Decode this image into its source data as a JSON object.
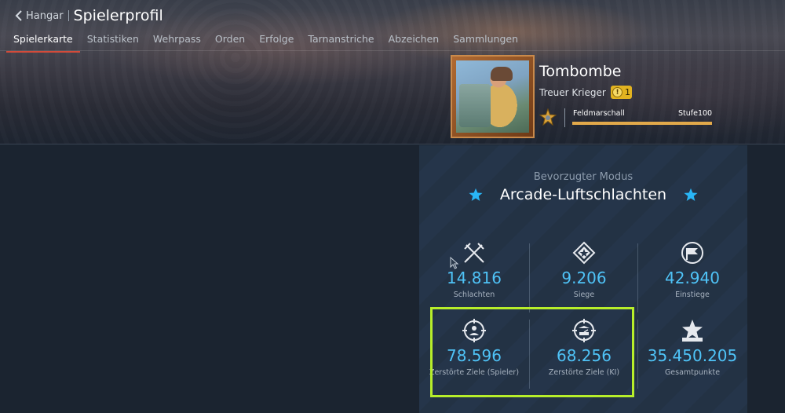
{
  "header": {
    "back_label": "Hangar",
    "title": "Spielerprofil",
    "tabs": [
      {
        "label": "Spielerkarte",
        "active": true
      },
      {
        "label": "Statistiken"
      },
      {
        "label": "Wehrpass"
      },
      {
        "label": "Orden"
      },
      {
        "label": "Erfolge"
      },
      {
        "label": "Tarnanstriche"
      },
      {
        "label": "Abzeichen"
      },
      {
        "label": "Sammlungen"
      }
    ]
  },
  "profile": {
    "name": "Tombombe",
    "title": "Treuer Krieger",
    "badge_count": "1",
    "rank_name": "Feldmarschall",
    "rank_level": "Stufe100",
    "rank_progress": 1.0
  },
  "stats": {
    "mode_label": "Bevorzugter Modus",
    "mode_name": "Arcade-Luftschlachten",
    "items": [
      {
        "icon": "crossed-swords-icon",
        "value": "14.816",
        "label": "Schlachten"
      },
      {
        "icon": "victory-diamond-icon",
        "value": "9.206",
        "label": "Siege"
      },
      {
        "icon": "flag-circle-icon",
        "value": "42.940",
        "label": "Einstiege"
      },
      {
        "icon": "crosshair-player-icon",
        "value": "78.596",
        "label": "Zerstörte Ziele (Spieler)"
      },
      {
        "icon": "crosshair-ai-icon",
        "value": "68.256",
        "label": "Zerstörte Ziele (KI)"
      },
      {
        "icon": "star-podium-icon",
        "value": "35.450.205",
        "label": "Gesamtpunkte"
      }
    ]
  },
  "colors": {
    "accent_value": "#4fc3f7",
    "tab_underline": "#d34b3a",
    "highlight_box": "#b7ee2a",
    "star": "#29b6f6"
  }
}
